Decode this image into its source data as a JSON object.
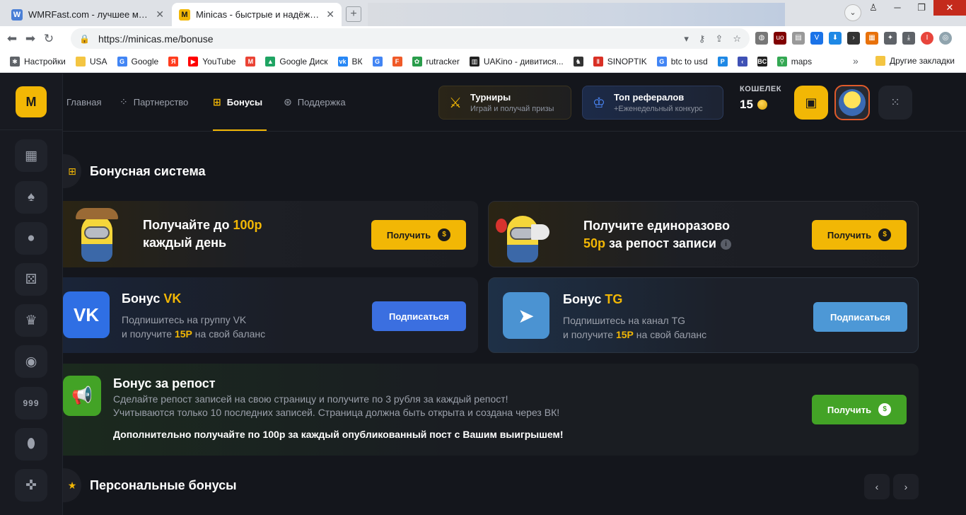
{
  "browser": {
    "tabs": [
      {
        "title": "WMRFast.com - лучшее место для",
        "favicon": "W"
      },
      {
        "title": "Minicas - быстрые и надёжные иг",
        "favicon": "M"
      }
    ],
    "url": "https://minicas.me/bonuse",
    "profile_initial": "I",
    "bookmarks": [
      {
        "label": "Настройки",
        "icon": "gear-icon",
        "color": "#5f6368"
      },
      {
        "label": "USA",
        "icon": "folder-icon",
        "color": "#f4c542"
      },
      {
        "label": "Google",
        "icon": "google-icon",
        "color": "#4285f4"
      },
      {
        "label": "",
        "icon": "yandex-icon",
        "color": "#ff3d1f"
      },
      {
        "label": "YouTube",
        "icon": "youtube-icon",
        "color": "#ff0000"
      },
      {
        "label": "",
        "icon": "gmail-icon",
        "color": "#ea4335"
      },
      {
        "label": "Google Диск",
        "icon": "drive-icon",
        "color": "#1fa463"
      },
      {
        "label": "ВК",
        "icon": "vk-icon",
        "color": "#2787f5"
      },
      {
        "label": "",
        "icon": "translate-icon",
        "color": "#4285f4"
      },
      {
        "label": "",
        "icon": "f-icon",
        "color": "#f05a28"
      },
      {
        "label": "rutracker",
        "icon": "rutracker-icon",
        "color": "#2a9d4b"
      },
      {
        "label": "UAKino - дивитися...",
        "icon": "uakino-icon",
        "color": "#222222"
      },
      {
        "label": "",
        "icon": "chess-icon",
        "color": "#333333"
      },
      {
        "label": "SINOPTIK",
        "icon": "thermometer-icon",
        "color": "#d93025"
      },
      {
        "label": "btc to usd",
        "icon": "google-icon",
        "color": "#4285f4"
      },
      {
        "label": "",
        "icon": "p-icon",
        "color": "#1e88e5"
      },
      {
        "label": "",
        "icon": "arrow-icon",
        "color": "#3f51b5"
      },
      {
        "label": "",
        "icon": "bc-icon",
        "color": "#222222"
      },
      {
        "label": "maps",
        "icon": "maps-icon",
        "color": "#34a853"
      }
    ],
    "bookmarks_more": "»",
    "other_bookmarks": "Другие закладки"
  },
  "site": {
    "logo": "M",
    "nav": [
      {
        "label": "Главная",
        "icon": "home-icon"
      },
      {
        "label": "Партнерство",
        "icon": "partners-icon"
      },
      {
        "label": "Бонусы",
        "icon": "gift-icon"
      },
      {
        "label": "Поддержка",
        "icon": "support-icon"
      }
    ],
    "promo_tournaments": {
      "title": "Турниры",
      "subtitle": "Играй и получай призы"
    },
    "promo_referrals": {
      "title": "Топ рефералов",
      "subtitle": "+Еженедельный конкурс"
    },
    "wallet": {
      "label": "КОШЕЛЕК",
      "value": "15"
    },
    "sidebar_slots_label": "999"
  },
  "bonus": {
    "section_title": "Бонусная система",
    "daily": {
      "line1_prefix": "Получайте до ",
      "line1_highlight": "100р",
      "line2": "каждый день",
      "button": "Получить"
    },
    "repost_once": {
      "line1": "Получите единоразово",
      "line2_highlight": "50р",
      "line2_suffix": " за репост записи",
      "button": "Получить"
    },
    "vk": {
      "title_prefix": "Бонус ",
      "title_highlight": "VK",
      "desc1": "Подпишитесь на группу VK",
      "desc2_prefix": "и получите ",
      "desc2_highlight": "15Р",
      "desc2_suffix": " на свой баланс",
      "button": "Подписаться"
    },
    "tg": {
      "title_prefix": "Бонус ",
      "title_highlight": "TG",
      "desc1": "Подпишитесь на канал TG",
      "desc2_prefix": "и получите ",
      "desc2_highlight": "15Р",
      "desc2_suffix": " на свой баланс",
      "button": "Подписаться"
    },
    "repost": {
      "title": "Бонус за репост",
      "desc1": "Сделайте репост записей на свою страницу и получите по 3 рубля за каждый репост!",
      "desc2": "Учитываются только 10 последних записей. Страница должна быть открыта и создана через ВК!",
      "extra": "Дополнительно получайте по 100р за каждый опубликованный пост с Вашим выигрышем!",
      "button": "Получить"
    },
    "personal_title": "Персональные бонусы"
  },
  "colors": {
    "accent": "#f2b705",
    "vk": "#2f6fe4",
    "tg": "#4b93d2",
    "green": "#43a326"
  }
}
